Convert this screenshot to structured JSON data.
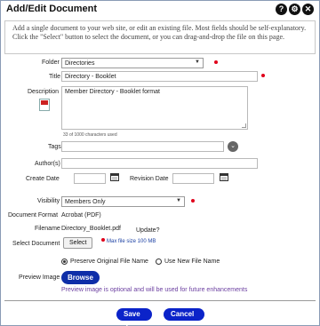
{
  "dialog": {
    "title": "Add/Edit Document",
    "help_icon": "question-circle-icon",
    "info_icon": "info-circle-icon",
    "close_icon": "close-circle-icon",
    "help_glyph": "?",
    "info_glyph": "⚙",
    "close_glyph": "✕",
    "intro": "Add a single document to your web site, or edit an existing file. Most fields should be self-explanatory. Click the \"Select\" button to select the document, or you can drag-and-drop the file on this page."
  },
  "form": {
    "folder_label": "Folder",
    "folder_value": "Directories",
    "title_label": "Title",
    "title_value": "Directory - Booklet",
    "description_label": "Description",
    "description_value": "Member Directory - Booklet format",
    "char_count": "33 of 1000 characters used",
    "tags_label": "Tags",
    "tags_value": "",
    "tags_toggle_glyph": "⌄",
    "authors_label": "Author(s)",
    "authors_value": "",
    "create_date_label": "Create Date",
    "create_date_value": "",
    "revision_date_label": "Revision Date",
    "revision_date_value": "",
    "visibility_label": "Visibility",
    "visibility_value": "Members Only",
    "document_format_label": "Document Format",
    "document_format_value": "Acrobat (PDF)",
    "filename_label": "Filename",
    "filename_value": "Directory_Booklet.pdf",
    "update_link": "Update?",
    "select_document_label": "Select Document",
    "select_button": "Select",
    "max_file_size": "Max file size 100 MB",
    "preserve_label": "Preserve Original File Name",
    "new_name_label": "Use New File Name",
    "preview_label": "Preview Image",
    "browse_button": "Browse",
    "preview_note": "Preview image is optional and will be used for future enhancements"
  },
  "footer": {
    "save_label": "Save",
    "save_glyph": "✓",
    "cancel_label": "Cancel"
  },
  "colors": {
    "primary_button": "#0b23c9",
    "required_marker": "#e0001a",
    "preview_note": "#6b3fa0"
  }
}
